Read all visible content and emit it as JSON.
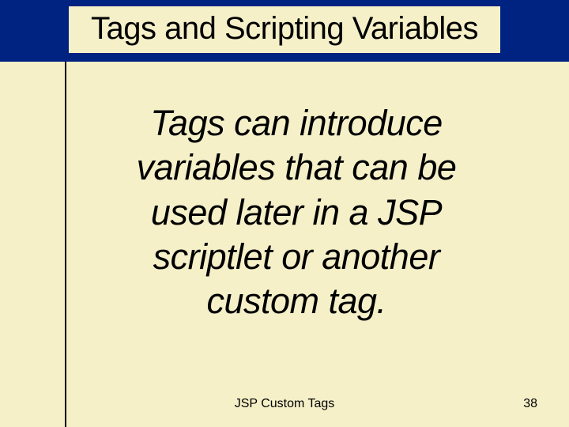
{
  "title": "Tags and Scripting Variables",
  "body": "Tags can introduce variables that can be used later in a JSP scriptlet or another custom tag.",
  "footer_title": "JSP Custom Tags",
  "page_number": "38"
}
